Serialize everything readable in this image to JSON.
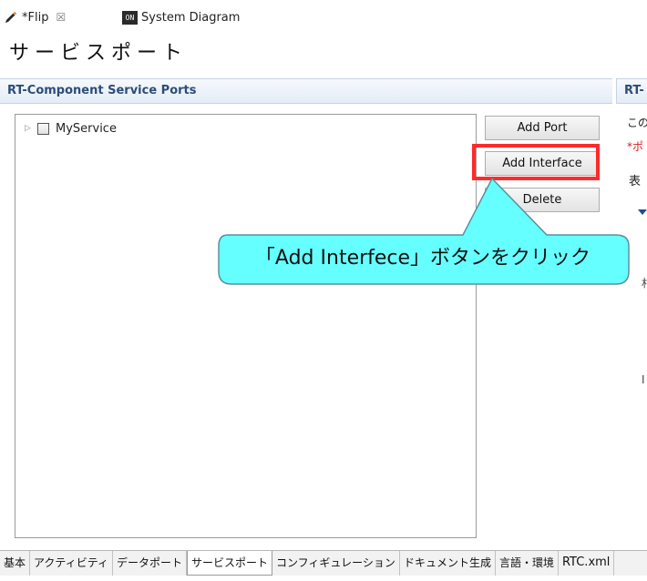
{
  "editor_tabs": [
    {
      "label": "*Flip",
      "close": "☒"
    },
    {
      "label": "System Diagram",
      "icon_text": "ON"
    }
  ],
  "page_title": "サービスポート",
  "section": {
    "title": "RT-Component Service Ports",
    "right_title": "RT-"
  },
  "tree": {
    "items": [
      {
        "label": "MyService"
      }
    ]
  },
  "buttons": {
    "add_port": "Add Port",
    "add_interface": "Add Interface",
    "delete": "Delete"
  },
  "callout": {
    "text": "「Add Interfece」ボタンをクリック",
    "fill": "#66ffff",
    "stroke": "#5a8fa0"
  },
  "right_panel": {
    "line1": "この",
    "line2": "*ポ",
    "line3": "表",
    "line4": "村",
    "line5": "I"
  },
  "bottom_tabs": [
    {
      "label": "基本"
    },
    {
      "label": "アクティビティ"
    },
    {
      "label": "データポート"
    },
    {
      "label": "サービスポート",
      "active": true
    },
    {
      "label": "コンフィギュレーション"
    },
    {
      "label": "ドキュメント生成"
    },
    {
      "label": "言語・環境"
    },
    {
      "label": "RTC.xml"
    }
  ],
  "colors": {
    "highlight": "#ff2b2b",
    "section_text": "#2c4d7a"
  }
}
